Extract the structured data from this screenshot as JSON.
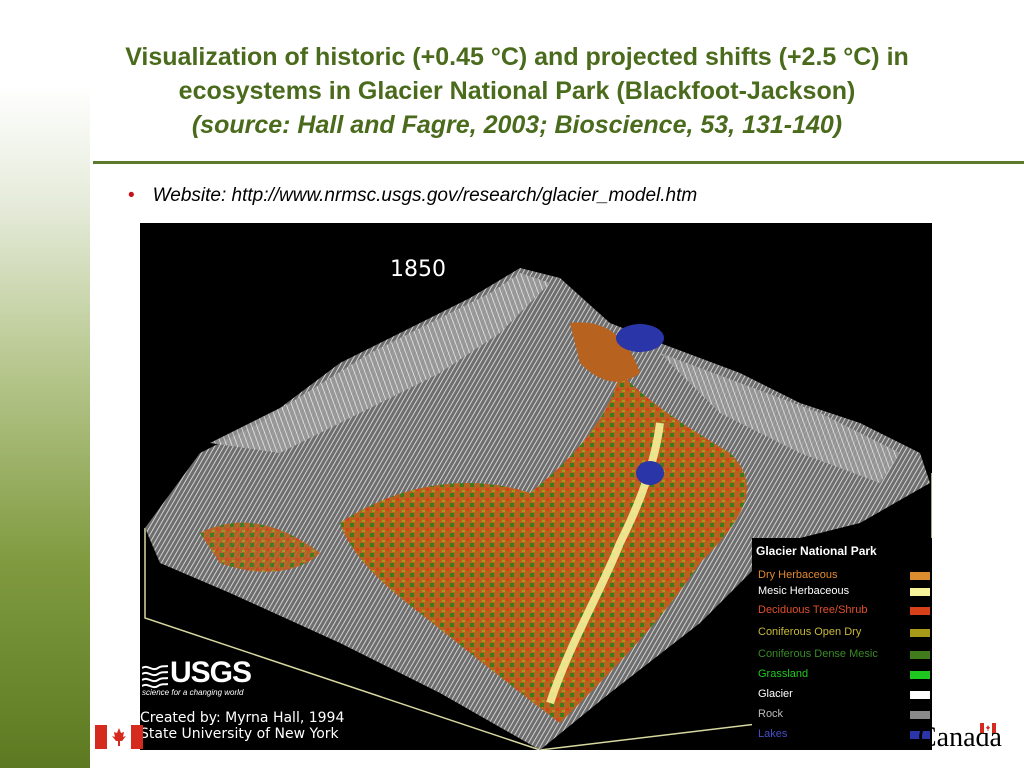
{
  "slide": {
    "title_line1": "Visualization of historic (+0.45 °C) and projected shifts (+2.5 °C) in",
    "title_line2": "ecosystems in Glacier National Park (Blackfoot-Jackson)",
    "title_source": "(source:  Hall and Fagre, 2003;  Bioscience, 53, 131-140)",
    "bullet": "Website:  http://www.nrmsc.usgs.gov/research/glacier_model.htm"
  },
  "figure": {
    "year": "1850",
    "legend_title": "Glacier National Park",
    "legend": [
      {
        "label": "Dry Herbaceous",
        "color": "#d98b2e",
        "text_color": "#e08a30"
      },
      {
        "label": "Mesic Herbaceous",
        "color": "#f6f29a",
        "text_color": "#ffffff"
      },
      {
        "label": "Deciduous Tree/Shrub",
        "color": "#d8401a",
        "text_color": "#e0502a"
      },
      {
        "label": "Coniferous Open Dry",
        "color": "#a89a18",
        "text_color": "#c8b83a"
      },
      {
        "label": "Coniferous Dense Mesic",
        "color": "#3f7a1c",
        "text_color": "#3a8a28"
      },
      {
        "label": "Grassland",
        "color": "#1ec81e",
        "text_color": "#22c822"
      },
      {
        "label": "Glacier",
        "color": "#ffffff",
        "text_color": "#ffffff"
      },
      {
        "label": "Rock",
        "color": "#8a8a8a",
        "text_color": "#bdbdbd"
      },
      {
        "label": "Lakes",
        "color": "#2a35a8",
        "text_color": "#4650c8"
      }
    ],
    "usgs_logo": "USGS",
    "usgs_tagline": "science for a changing world",
    "credit_line1": "Created by:  Myrna Hall, 1994",
    "credit_line2": "State University of New York"
  },
  "footer": {
    "canada_wordmark": "Canada"
  }
}
